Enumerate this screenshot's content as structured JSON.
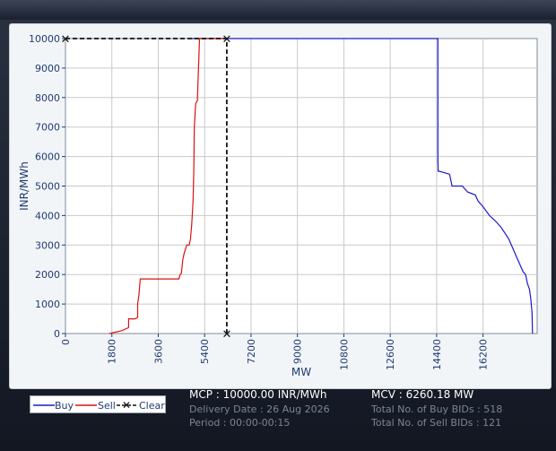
{
  "chart_data": {
    "type": "line",
    "xlabel": "MW",
    "ylabel": "INR/MWh",
    "xlim": [
      0,
      18300
    ],
    "ylim": [
      0,
      10000
    ],
    "x_ticks": [
      "0",
      "1800",
      "3600",
      "5400",
      "7200",
      "9000",
      "10800",
      "12600",
      "14400",
      "16200"
    ],
    "x_tick_values": [
      0,
      1800,
      3600,
      5400,
      7200,
      9000,
      10800,
      12600,
      14400,
      16200
    ],
    "y_ticks": [
      "0",
      "1000",
      "2000",
      "3000",
      "4000",
      "5000",
      "6000",
      "7000",
      "8000",
      "9000",
      "10000"
    ],
    "y_tick_values": [
      0,
      1000,
      2000,
      3000,
      4000,
      5000,
      6000,
      7000,
      8000,
      9000,
      10000
    ],
    "grid": true,
    "legend_position": "bottom-left",
    "series": [
      {
        "name": "Buy",
        "color": "#1a1acc",
        "x": [
          4900,
          6260,
          9000,
          12000,
          14450,
          14450,
          14460,
          14500,
          14900,
          14950,
          15000,
          15350,
          15400,
          15600,
          15900,
          16000,
          16200,
          16450,
          16700,
          16900,
          17050,
          17200,
          17350,
          17500,
          17650,
          17750,
          17850,
          17920,
          18000,
          18050,
          18100,
          18120
        ],
        "y": [
          10000,
          10000,
          10000,
          10000,
          10000,
          5900,
          5500,
          5500,
          5400,
          5200,
          5000,
          5000,
          5000,
          4800,
          4700,
          4500,
          4300,
          4000,
          3800,
          3600,
          3400,
          3200,
          2900,
          2600,
          2300,
          2100,
          2000,
          1700,
          1500,
          1200,
          700,
          0
        ]
      },
      {
        "name": "Sell",
        "color": "#dd1111",
        "x": [
          1700,
          2200,
          2450,
          2450,
          2700,
          2800,
          2800,
          2850,
          2900,
          4400,
          4450,
          4500,
          4550,
          4600,
          4700,
          4800,
          4850,
          4900,
          4950,
          4980,
          5000,
          5050,
          5120,
          5120,
          5200,
          5300,
          5400,
          5500,
          6260
        ],
        "y": [
          0,
          100,
          200,
          500,
          500,
          550,
          1000,
          1300,
          1850,
          1850,
          2000,
          2050,
          2500,
          2700,
          3000,
          3000,
          3200,
          3700,
          4500,
          5500,
          7000,
          7800,
          7900,
          8000,
          10000,
          10000,
          10000,
          10000,
          10000
        ]
      },
      {
        "name": "Clear",
        "color": "#111111",
        "x": [
          0,
          6260,
          6260
        ],
        "y": [
          10000,
          10000,
          0
        ]
      }
    ]
  },
  "summary": {
    "mcp": "MCP : 10000.00 INR/MWh",
    "mcv": "MCV : 6260.18 MW",
    "delivery_date": "Delivery Date : 26 Aug 2026",
    "period": "Period :  00:00-00:15",
    "buy_bids": "Total No. of Buy BIDs : 518",
    "sell_bids": "Total No. of Sell BIDs : 121"
  }
}
